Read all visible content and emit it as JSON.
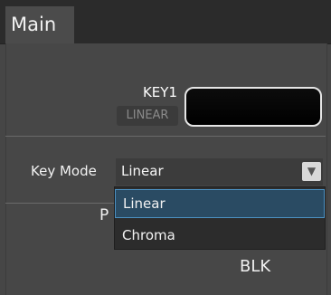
{
  "tabs": [
    {
      "label": "Main"
    }
  ],
  "key": {
    "title": "KEY1",
    "badge": "LINEAR"
  },
  "key_mode": {
    "label": "Key Mode",
    "selected": "Linear",
    "options": [
      {
        "label": "Linear",
        "selected": true
      },
      {
        "label": "Chroma",
        "selected": false
      }
    ]
  },
  "background": {
    "partial_label": "P",
    "blk_label": "BLK"
  },
  "colors": {
    "selection_fill": "#2a4b63",
    "selection_border": "#4c91c2",
    "panel_bg": "#474747"
  }
}
